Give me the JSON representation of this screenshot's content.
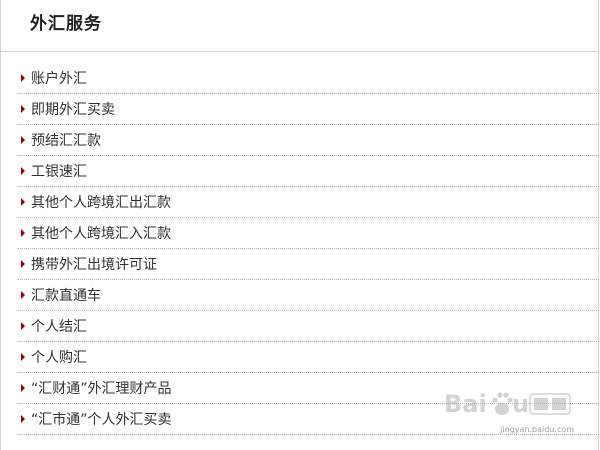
{
  "panel": {
    "title": "外汇服务"
  },
  "menu": {
    "items": [
      {
        "label": "账户外汇"
      },
      {
        "label": "即期外汇买卖"
      },
      {
        "label": "预结汇汇款"
      },
      {
        "label": "工银速汇"
      },
      {
        "label": "其他个人跨境汇出汇款"
      },
      {
        "label": "其他个人跨境汇入汇款"
      },
      {
        "label": "携带外汇出境许可证"
      },
      {
        "label": "汇款直通车"
      },
      {
        "label": "个人结汇"
      },
      {
        "label": "个人购汇"
      },
      {
        "label": "“汇财通”外汇理财产品"
      },
      {
        "label": "“汇市通”个人外汇买卖"
      }
    ]
  },
  "watermark": {
    "site": "jingyan.baidu.com"
  },
  "colors": {
    "arrow": "#a40000",
    "border": "#d6d6d6",
    "text": "#333333"
  },
  "icons": {
    "menu_bullet": "triangle-right-icon",
    "watermark_logo": "baidu-paw-logo"
  }
}
